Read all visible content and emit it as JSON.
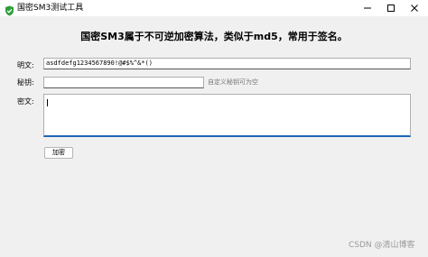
{
  "window": {
    "title": "国密SM3测试工具",
    "icon": "shield-check-icon",
    "controls": [
      "minimize-icon",
      "maximize-icon",
      "close-icon"
    ]
  },
  "heading": "国密SM3属于不可逆加密算法，类似于md5，常用于签名。",
  "form": {
    "plaintext_label": "明文:",
    "plaintext_value": "asdfdefg1234567890!@#$%^&*()",
    "key_label": "秘钥:",
    "key_value": "",
    "key_hint": "自定义秘钥可为空",
    "ciphertext_label": "密文:",
    "ciphertext_value": ""
  },
  "encrypt_button": "加密",
  "watermark": "CSDN @清山博客",
  "colors": {
    "focus_border": "#1e66b8",
    "app_icon": "#2e9e3a"
  }
}
